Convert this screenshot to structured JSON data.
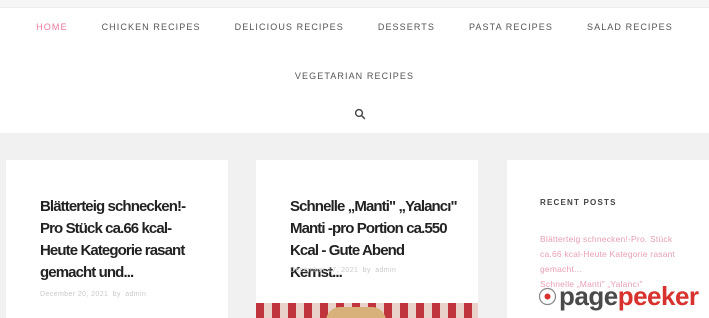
{
  "nav": {
    "items": [
      {
        "label": "HOME",
        "active": true
      },
      {
        "label": "CHICKEN RECIPES",
        "active": false
      },
      {
        "label": "DELICIOUS RECIPES",
        "active": false
      },
      {
        "label": "DESSERTS",
        "active": false
      },
      {
        "label": "PASTA RECIPES",
        "active": false
      },
      {
        "label": "SALAD RECIPES",
        "active": false
      }
    ],
    "items_row2": [
      {
        "label": "VEGETARIAN RECIPES"
      }
    ],
    "search_icon": "search-icon",
    "active_color": "#e87a9a"
  },
  "posts": [
    {
      "title": "Blätterteig schnecken!-Pro Stück ca.66 kcal-Heute Kategorie rasant gemacht und...",
      "date": "December 20, 2021",
      "by": "by",
      "author": "admin"
    },
    {
      "title": "Schnelle „Manti\" „Yalancı\" Manti -pro Portion ca.550 Kcal - Gute Abend Kernst...",
      "date": "December 17, 2021",
      "by": "by",
      "author": "admin"
    }
  ],
  "sidebar": {
    "widget_title": "RECENT POSTS",
    "recent": [
      "Blätterteig schnecken!-Pro. Stück ca.66 kcal-Heute Kategorie rasant gemacht...",
      "Schnelle „Manti\" „Yalancı\""
    ],
    "link_color": "#e8a0b4"
  },
  "watermark": {
    "prefix": "page",
    "accent": "peeker",
    "accent_color": "#d7322d"
  }
}
